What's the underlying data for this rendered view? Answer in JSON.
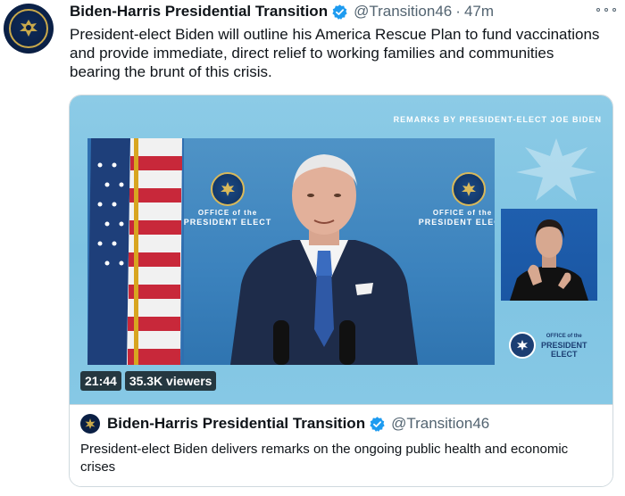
{
  "tweet": {
    "display_name": "Biden-Harris Presidential Transition",
    "handle": "@Transition46",
    "separator": "·",
    "time": "47m",
    "text": "President-elect Biden will outline his America Rescue Plan to fund vaccinations and provide immediate, direct relief to working families and communities bearing the brunt of this crisis."
  },
  "video": {
    "banner": "REMARKS BY PRESIDENT-ELECT JOE BIDEN",
    "wall_text_left_1": "OFFICE of the",
    "wall_text_left_2": "PRESIDENT ELECT",
    "wall_text_right_1": "OFFICE of the",
    "wall_text_right_2": "PRESIDENT ELECT",
    "logo_small": "OFFICE of the",
    "logo_line1": "PRESIDENT",
    "logo_line2": "ELECT",
    "duration": "21:44",
    "viewers": "35.3K viewers"
  },
  "card": {
    "display_name": "Biden-Harris Presidential Transition",
    "handle": "@Transition46",
    "description": "President-elect Biden delivers remarks on the ongoing public health and economic crises"
  },
  "colors": {
    "verified": "#1d9bf0",
    "navy": "#0a1f44",
    "gold": "#c9a94b",
    "sky": "#8ccbe6"
  },
  "icons": {
    "verified": "verified-badge-icon",
    "more": "more-icon",
    "seal": "seal-icon"
  }
}
